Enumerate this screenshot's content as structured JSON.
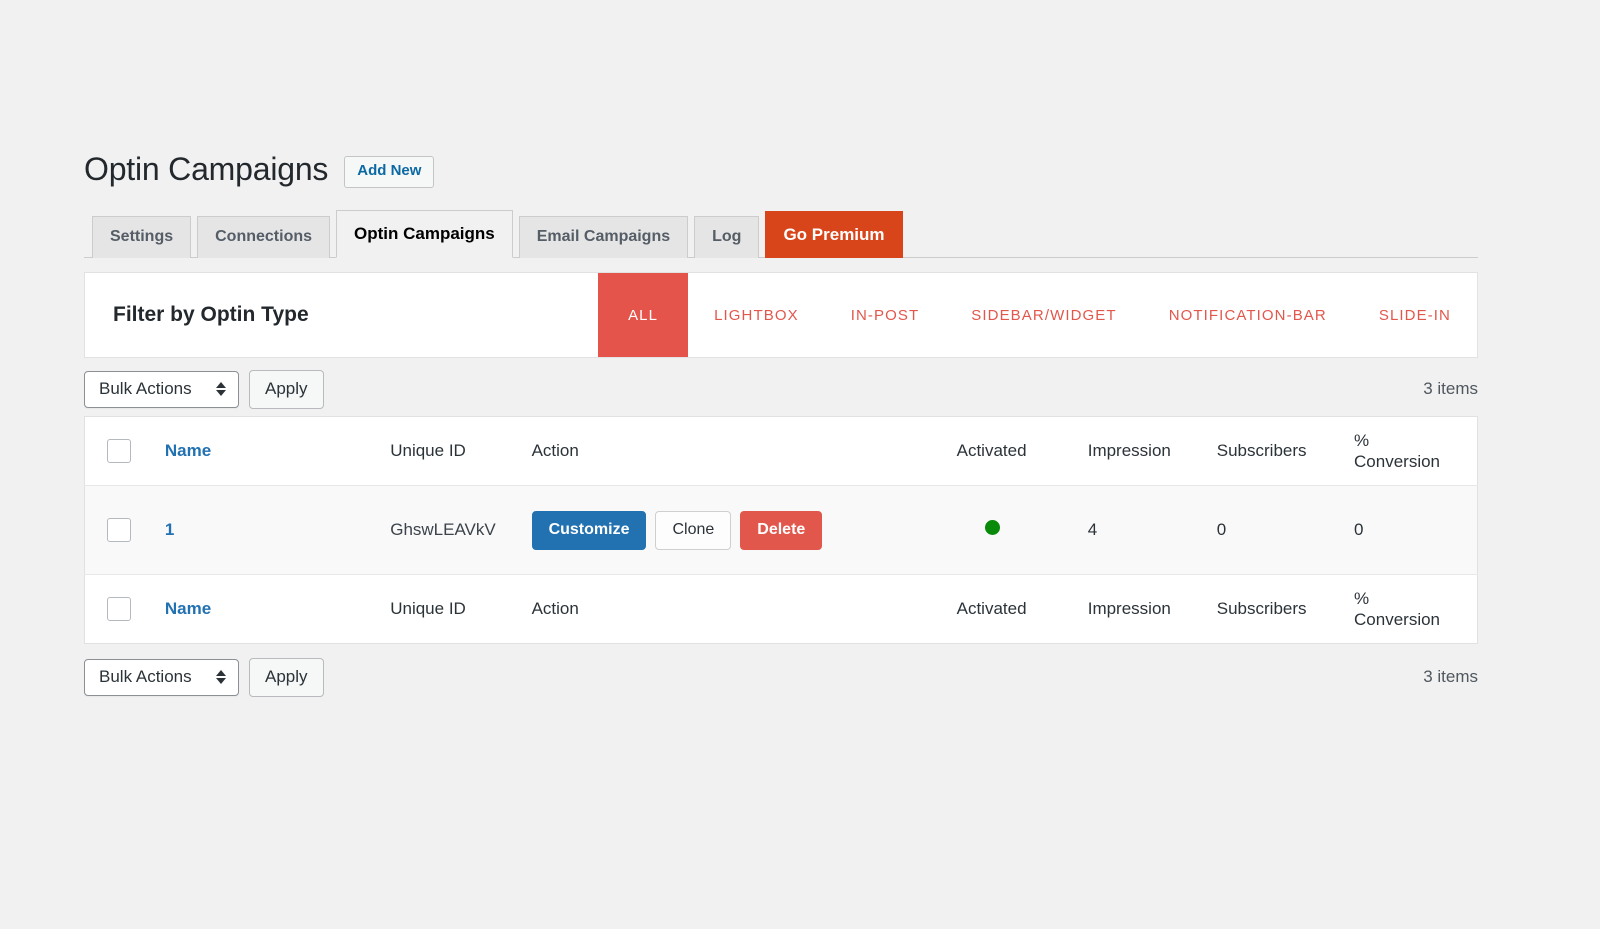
{
  "header": {
    "title": "Optin Campaigns",
    "add_new_label": "Add New"
  },
  "tabs": [
    {
      "label": "Settings",
      "state": "normal"
    },
    {
      "label": "Connections",
      "state": "normal"
    },
    {
      "label": "Optin Campaigns",
      "state": "active"
    },
    {
      "label": "Email Campaigns",
      "state": "normal"
    },
    {
      "label": "Log",
      "state": "normal"
    },
    {
      "label": "Go Premium",
      "state": "premium"
    }
  ],
  "filter": {
    "label": "Filter by Optin Type",
    "items": [
      {
        "label": "ALL",
        "active": true
      },
      {
        "label": "LIGHTBOX",
        "active": false
      },
      {
        "label": "IN-POST",
        "active": false
      },
      {
        "label": "SIDEBAR/WIDGET",
        "active": false
      },
      {
        "label": "NOTIFICATION-BAR",
        "active": false
      },
      {
        "label": "SLIDE-IN",
        "active": false
      }
    ]
  },
  "bulk": {
    "selected_option": "Bulk Actions",
    "options": [
      "Bulk Actions"
    ],
    "apply_label": "Apply",
    "items_count": "3 items"
  },
  "table": {
    "columns": {
      "name": "Name",
      "unique_id": "Unique ID",
      "action": "Action",
      "activated": "Activated",
      "impression": "Impression",
      "subscribers": "Subscribers",
      "conversion_line1": "%",
      "conversion_line2": "Conversion"
    },
    "rows": [
      {
        "name": "1",
        "unique_id": "GhswLEAVkV",
        "actions": {
          "customize": "Customize",
          "clone": "Clone",
          "delete": "Delete"
        },
        "activated": true,
        "impression": "4",
        "subscribers": "0",
        "conversion": "0"
      }
    ]
  },
  "colors": {
    "page_background": "#f1f1f1",
    "filter_active": "#e5544a",
    "filter_text": "#e2574c",
    "premium_tab": "#d9451b",
    "primary_button": "#2271b1",
    "danger_button": "#e2574c",
    "link": "#2271b1",
    "status_active": "#0a8a0a"
  }
}
